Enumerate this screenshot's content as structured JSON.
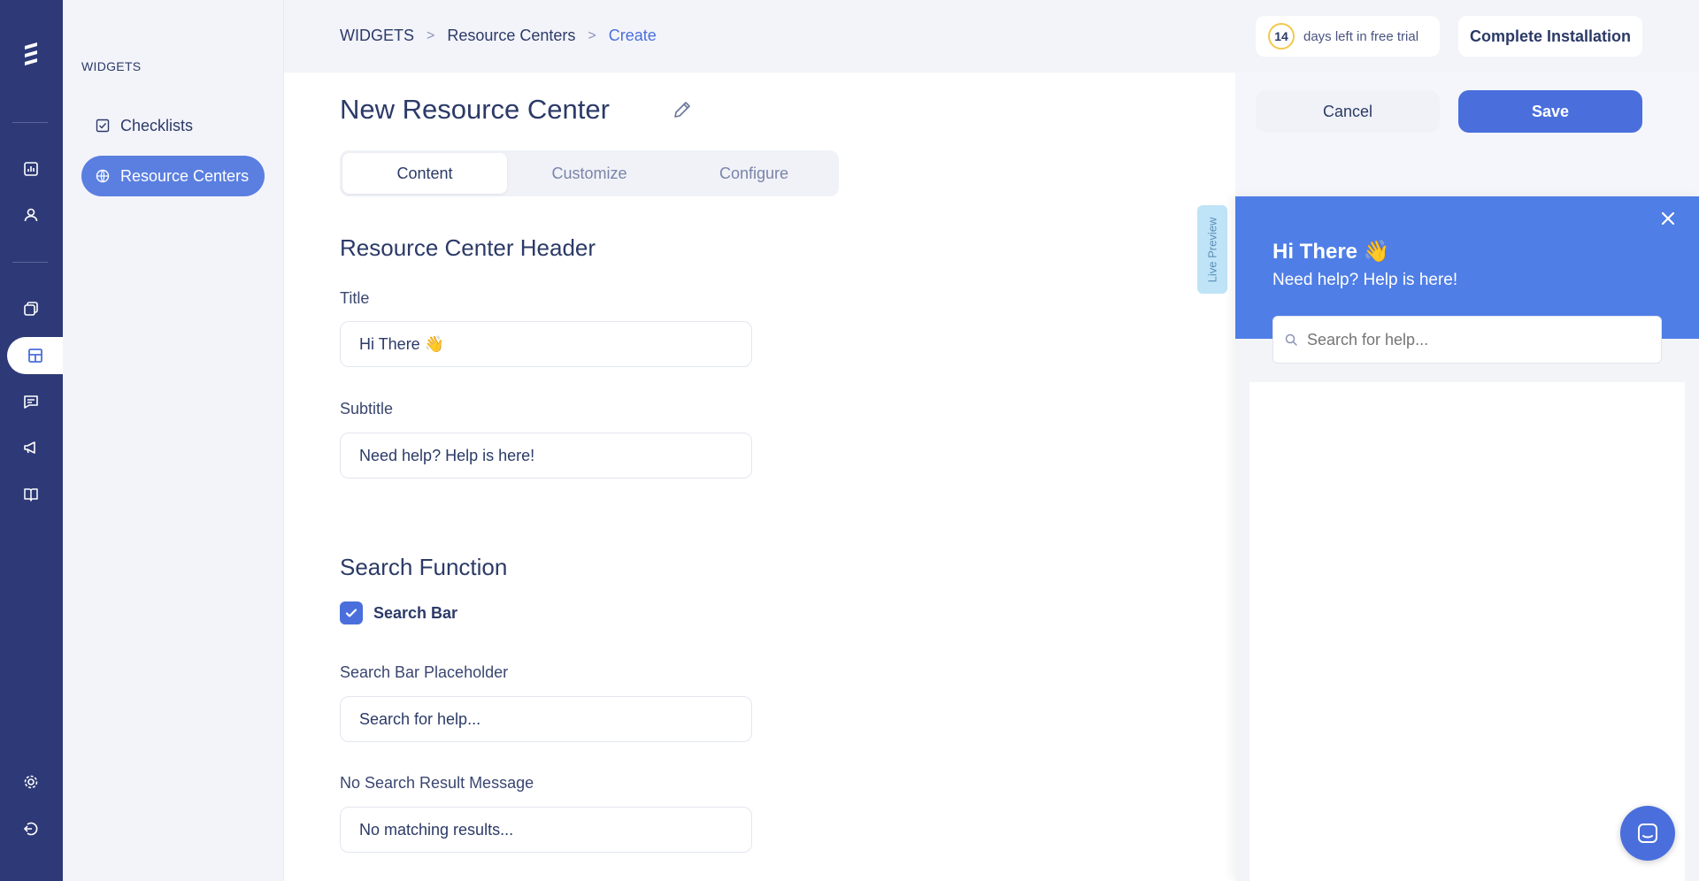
{
  "breadcrumb": {
    "items": [
      "WIDGETS",
      "Resource Centers"
    ],
    "current": "Create",
    "separator": ">"
  },
  "trial": {
    "days": "14",
    "text": "days left in free trial"
  },
  "topbar": {
    "install_label": "Complete Installation"
  },
  "sidebar": {
    "heading": "WIDGETS",
    "items": [
      {
        "label": "Checklists",
        "icon": "checkbox-icon"
      },
      {
        "label": "Resource Centers",
        "icon": "globe-icon",
        "active": true
      }
    ]
  },
  "rail": {
    "icons": [
      "logo-icon",
      "analytics-icon",
      "user-icon",
      "copy-icon",
      "widgets-icon",
      "messages-icon",
      "megaphone-icon",
      "book-icon",
      "gear-icon",
      "logout-icon"
    ]
  },
  "page": {
    "title": "New Resource Center",
    "cancel_label": "Cancel",
    "save_label": "Save",
    "tabs": [
      "Content",
      "Customize",
      "Configure"
    ],
    "active_tab": "Content"
  },
  "form": {
    "header_section": "Resource Center Header",
    "title_label": "Title",
    "title_value": "Hi There 👋",
    "subtitle_label": "Subtitle",
    "subtitle_value": "Need help? Help is here!",
    "search_section": "Search Function",
    "search_bar_label": "Search Bar",
    "search_bar_checked": true,
    "placeholder_label": "Search Bar Placeholder",
    "placeholder_value": "Search for help...",
    "no_result_label": "No Search Result Message",
    "no_result_value": "No matching results..."
  },
  "preview": {
    "tab_label": "Live Preview",
    "title": "Hi There 👋",
    "subtitle": "Need help? Help is here!",
    "search_placeholder": "Search for help..."
  },
  "colors": {
    "rail": "#2e3a77",
    "accent": "#4a6fdc",
    "sidebar_active": "#5a7fe0",
    "preview_header": "#4f7ee6",
    "live_tab": "#bfe3f7",
    "trial_ring": "#f2c94c"
  }
}
